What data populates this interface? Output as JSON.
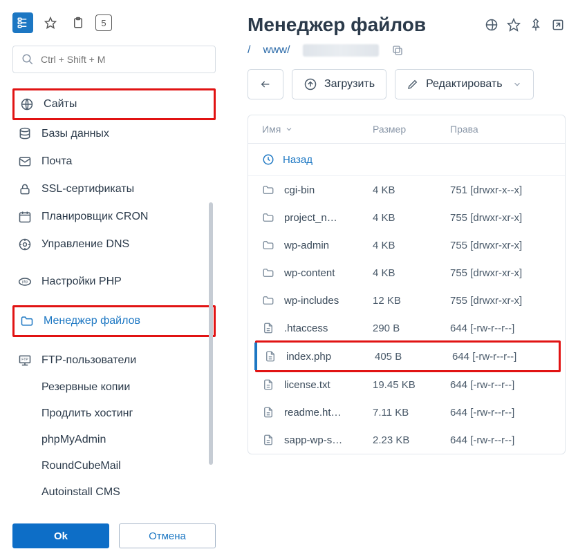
{
  "search": {
    "placeholder": "Ctrl + Shift + M"
  },
  "sidebar": {
    "items": [
      {
        "label": "Сайты"
      },
      {
        "label": "Базы данных"
      },
      {
        "label": "Почта"
      },
      {
        "label": "SSL-сертификаты"
      },
      {
        "label": "Планировщик CRON"
      },
      {
        "label": "Управление DNS"
      },
      {
        "label": "Настройки PHP"
      },
      {
        "label": "Менеджер файлов"
      },
      {
        "label": "FTP-пользователи"
      },
      {
        "label": "Резервные копии"
      },
      {
        "label": "Продлить хостинг"
      },
      {
        "label": "phpMyAdmin"
      },
      {
        "label": "RoundCubeMail"
      },
      {
        "label": "Autoinstall CMS"
      }
    ]
  },
  "buttons": {
    "ok": "Ok",
    "cancel": "Отмена"
  },
  "main": {
    "title": "Менеджер файлов",
    "breadcrumb": {
      "root": "/",
      "segment1": "www/"
    },
    "toolbar": {
      "upload": "Загрузить",
      "edit": "Редактировать"
    },
    "columns": {
      "name": "Имя",
      "size": "Размер",
      "perm": "Права"
    },
    "back": "Назад",
    "rows": [
      {
        "type": "folder",
        "name": "cgi-bin",
        "size": "4 KB",
        "perm": "751 [drwxr-x--x]"
      },
      {
        "type": "folder",
        "name": "project_n…",
        "size": "4 KB",
        "perm": "755 [drwxr-xr-x]"
      },
      {
        "type": "folder",
        "name": "wp-admin",
        "size": "4 KB",
        "perm": "755 [drwxr-xr-x]"
      },
      {
        "type": "folder",
        "name": "wp-content",
        "size": "4 KB",
        "perm": "755 [drwxr-xr-x]"
      },
      {
        "type": "folder",
        "name": "wp-includes",
        "size": "12 KB",
        "perm": "755 [drwxr-xr-x]"
      },
      {
        "type": "file",
        "name": ".htaccess",
        "size": "290 B",
        "perm": "644 [-rw-r--r--]"
      },
      {
        "type": "file",
        "name": "index.php",
        "size": "405 B",
        "perm": "644 [-rw-r--r--]"
      },
      {
        "type": "file",
        "name": "license.txt",
        "size": "19.45 KB",
        "perm": "644 [-rw-r--r--]"
      },
      {
        "type": "file",
        "name": "readme.ht…",
        "size": "7.11 KB",
        "perm": "644 [-rw-r--r--]"
      },
      {
        "type": "file",
        "name": "sapp-wp-s…",
        "size": "2.23 KB",
        "perm": "644 [-rw-r--r--]"
      }
    ]
  }
}
